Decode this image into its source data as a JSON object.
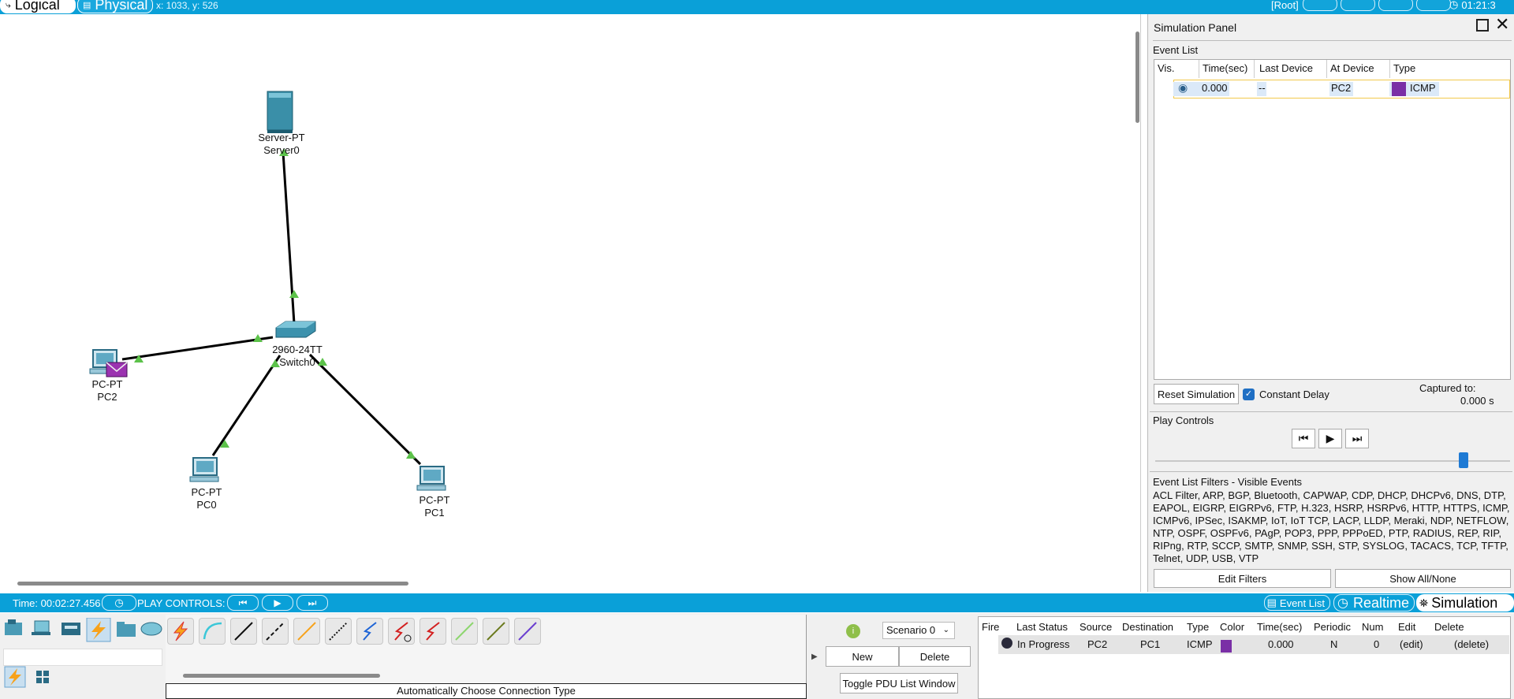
{
  "top_bar": {
    "tabs": [
      {
        "label": "Logical",
        "icon": "logical-icon",
        "active": true
      },
      {
        "label": "Physical",
        "icon": "physical-icon",
        "active": false
      }
    ],
    "coordinates": "x: 1033, y: 526",
    "root_label": "[Root]",
    "clock": "01:21:3"
  },
  "topology": {
    "devices": [
      {
        "model": "Server-PT",
        "name": "Server0",
        "icon": "server-icon"
      },
      {
        "model": "2960-24TT",
        "name": "Switch0",
        "icon": "switch-icon"
      },
      {
        "model": "PC-PT",
        "name": "PC2",
        "icon": "pc-icon",
        "has_pdu": true
      },
      {
        "model": "PC-PT",
        "name": "PC0",
        "icon": "pc-icon"
      },
      {
        "model": "PC-PT",
        "name": "PC1",
        "icon": "pc-icon"
      }
    ],
    "link_color": "#000000",
    "port_indicator_color": "#5cc24a",
    "pdu_color": "#8a2fa6"
  },
  "simulation_panel": {
    "title": "Simulation Panel",
    "event_list_title": "Event List",
    "columns": [
      "Vis.",
      "Time(sec)",
      "Last Device",
      "At Device",
      "Type"
    ],
    "events": [
      {
        "vis_icon": "eye-icon",
        "time": "0.000",
        "last_device": "--",
        "at_device": "PC2",
        "type": "ICMP",
        "color": "#7a2fa6"
      }
    ],
    "reset_button": "Reset Simulation",
    "constant_delay_label": "Constant Delay",
    "constant_delay_checked": true,
    "captured_to_label": "Captured to:",
    "captured_to_value": "0.000 s",
    "play_controls_title": "Play Controls",
    "play_buttons": [
      "step-back-icon",
      "play-icon",
      "step-forward-icon"
    ],
    "filters_title": "Event List Filters - Visible Events",
    "filters_list": "ACL Filter, ARP, BGP, Bluetooth, CAPWAP, CDP, DHCP, DHCPv6, DNS, DTP, EAPOL, EIGRP, EIGRPv6, FTP, H.323, HSRP, HSRPv6, HTTP, HTTPS, ICMP, ICMPv6, IPSec, ISAKMP, IoT, IoT TCP, LACP, LLDP, Meraki, NDP, NETFLOW, NTP, OSPF, OSPFv6, PAgP, POP3, PPP, PPPoED, PTP, RADIUS, REP, RIP, RIPng, RTP, SCCP, SMTP, SNMP, SSH, STP, SYSLOG, TACACS, TCP, TFTP, Telnet, UDP, USB, VTP",
    "edit_filters_button": "Edit Filters",
    "show_all_button": "Show All/None"
  },
  "bottom_bar": {
    "time": "Time: 00:02:27.456",
    "play_controls_label": "PLAY CONTROLS:",
    "event_list_button": "Event List",
    "realtime_label": "Realtime",
    "simulation_label": "Simulation",
    "accent": "#0aa0d8"
  },
  "device_palette": {
    "categories": [
      "network-devices-icon",
      "end-devices-icon",
      "components-icon",
      "connections-icon",
      "misc-icon",
      "multiuser-icon"
    ],
    "connections": [
      "automatic-connection-icon",
      "console-cable-icon",
      "copper-straight-icon",
      "copper-cross-icon",
      "fiber-icon",
      "phone-cable-icon",
      "coaxial-icon",
      "serial-dce-icon",
      "serial-dte-icon",
      "octal-cable-icon",
      "iot-cable-icon",
      "usb-cable-icon"
    ],
    "connection_type_label": "Automatically Choose Connection Type"
  },
  "scenario": {
    "selected": "Scenario 0",
    "new_button": "New",
    "delete_button": "Delete",
    "toggle_button": "Toggle PDU List Window"
  },
  "pdu_list": {
    "columns": [
      "Fire",
      "Last Status",
      "Source",
      "Destination",
      "Type",
      "Color",
      "Time(sec)",
      "Periodic",
      "Num",
      "Edit",
      "Delete"
    ],
    "rows": [
      {
        "fire_icon": "fire-icon",
        "last_status": "In Progress",
        "source": "PC2",
        "destination": "PC1",
        "type": "ICMP",
        "color": "#7a2fa6",
        "time": "0.000",
        "periodic": "N",
        "num": "0",
        "edit": "(edit)",
        "delete": "(delete)"
      }
    ]
  }
}
